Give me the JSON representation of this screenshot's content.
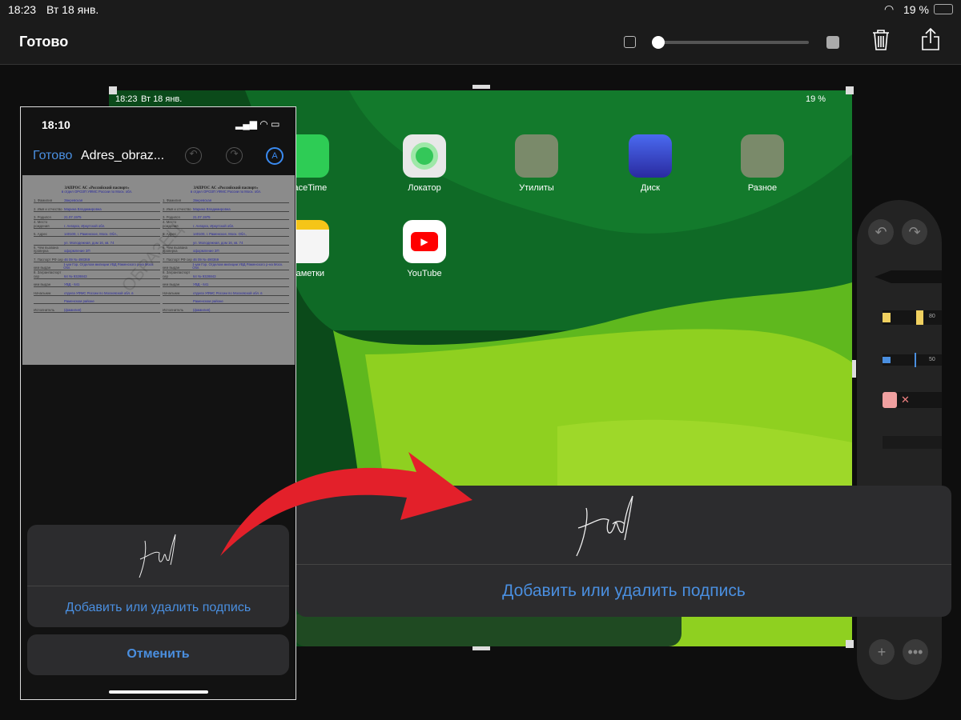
{
  "status": {
    "time": "18:23",
    "date": "Вт 18 янв.",
    "battery": "19 %"
  },
  "toolbar": {
    "done": "Готово",
    "opacity_level": 0
  },
  "ipad": {
    "time": "18:23",
    "date": "Вт 18 янв.",
    "battery": "19 %",
    "apps": [
      {
        "label": "FaceTime",
        "color": "#2ecc55"
      },
      {
        "label": "Локатор",
        "color": "#e8e8e8"
      },
      {
        "label": "Утилиты",
        "color": "#7a8a6a"
      },
      {
        "label": "Диск",
        "color": "#3a5ae0"
      },
      {
        "label": "Разное",
        "color": "#7a8a6a"
      },
      {
        "label": "Заметки",
        "color": "#f5f5f5"
      },
      {
        "label": "YouTube",
        "color": "#ffffff"
      }
    ]
  },
  "phone": {
    "time": "18:10",
    "done": "Готово",
    "title": "Adres_obraz...",
    "doc": {
      "title": "ЗАПРОС АС «Российский паспорт»",
      "subtitle": "в отдел ОРОЗП УФМС России по Моск. обл.",
      "watermark": "ОБРАЗЕЦ",
      "fields": [
        {
          "k": "1. Фамилия",
          "v": "Зверевская"
        },
        {
          "k": "2. Имя и отчество",
          "v": "Марина Владимировна"
        },
        {
          "k": "3. Родился",
          "v": "21.07.1975"
        },
        {
          "k": "4. Место рождения",
          "v": "г. Ангарск, Иркутской обл."
        },
        {
          "k": "5. Адрес",
          "v": "140100, г. Раменское, Моск. Обл.,"
        },
        {
          "k": "",
          "v": "ул. Молодежная, дом 16, кв. 74"
        },
        {
          "k": "6. Чем вызвана проверка",
          "v": "оформление ЗП"
        },
        {
          "k": "7. Паспорт РФ сер",
          "v": "46 09 № 490369"
        },
        {
          "k": "кем выдан",
          "v": "1-ым Гор. Отделом милиции УВД Раменского р-на Моск. Обл."
        },
        {
          "k": "8. Загранпаспорт сер",
          "v": "64 № 9328843"
        },
        {
          "k": "кем выдан",
          "v": "УВД - 641"
        },
        {
          "k": "Начальник",
          "v": "отдела УФМС России по Московской обл. в"
        },
        {
          "k": "",
          "v": "Раменском районе"
        },
        {
          "k": "Исполнитель",
          "v": "(фамилия)"
        }
      ]
    },
    "add_signature": "Добавить или удалить подпись",
    "cancel": "Отменить"
  },
  "popup": {
    "add_signature": "Добавить или удалить подпись"
  },
  "palette": {
    "marker_width": "80",
    "pen_width": "50"
  },
  "colors": {
    "accent": "#4a8fe0",
    "arrow": "#e3202a"
  }
}
